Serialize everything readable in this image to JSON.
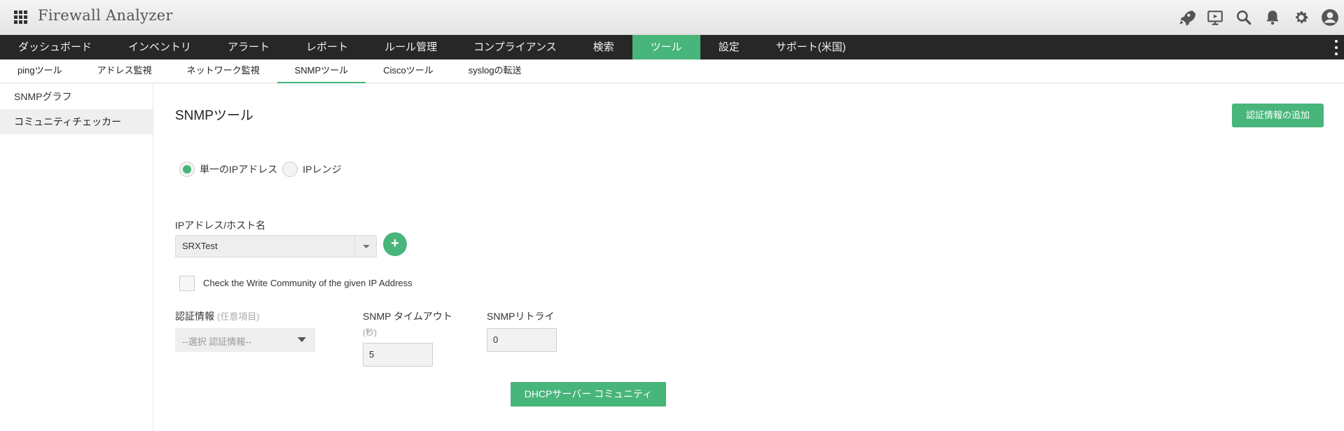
{
  "header": {
    "app_title": "Firewall Analyzer",
    "icons": [
      "apps-grid-icon",
      "rocket-icon",
      "presentation-icon",
      "search-icon",
      "bell-icon",
      "gear-icon",
      "user-icon"
    ]
  },
  "main_nav": {
    "items": [
      {
        "label": "ダッシュボード"
      },
      {
        "label": "インベントリ"
      },
      {
        "label": "アラート"
      },
      {
        "label": "レポート"
      },
      {
        "label": "ルール管理"
      },
      {
        "label": "コンプライアンス"
      },
      {
        "label": "検索"
      },
      {
        "label": "ツール"
      },
      {
        "label": "設定"
      },
      {
        "label": "サポート(米国)"
      }
    ],
    "active": "ツール",
    "more_icon": "vertical-dots-icon"
  },
  "sub_nav": {
    "items": [
      {
        "label": "pingツール"
      },
      {
        "label": "アドレス監視"
      },
      {
        "label": "ネットワーク監視"
      },
      {
        "label": "SNMPツール"
      },
      {
        "label": "Ciscoツール"
      },
      {
        "label": "syslogの転送"
      }
    ],
    "active": "SNMPツール"
  },
  "sidebar": {
    "items": [
      {
        "label": "SNMPグラフ"
      },
      {
        "label": "コミュニティチェッカー"
      }
    ],
    "active": "コミュニティチェッカー"
  },
  "main": {
    "title": "SNMPツール",
    "add_credentials_button": "認証情報の追加",
    "radio_options": [
      {
        "label": "単一のIPアドレス",
        "selected": true
      },
      {
        "label": "IPレンジ",
        "selected": false
      }
    ],
    "ip_field": {
      "label": "IPアドレス/ホスト名",
      "value": "SRXTest"
    },
    "write_community_checkbox": {
      "label": "Check the Write Community of the given IP Address",
      "checked": false
    },
    "credential": {
      "label": "認証情報",
      "optional_label": "(任意項目)",
      "placeholder": "--選択 認証情報--"
    },
    "snmp_timeout": {
      "label": "SNMP タイムアウト",
      "unit": "(秒)",
      "value": "5"
    },
    "snmp_retry": {
      "label": "SNMPリトライ",
      "value": "0"
    },
    "dhcp_button": "DHCPサーバー コミュニティ"
  },
  "colors": {
    "accent": "#48b57a",
    "nav_bg": "#272727",
    "header_bg": "#ececec"
  }
}
